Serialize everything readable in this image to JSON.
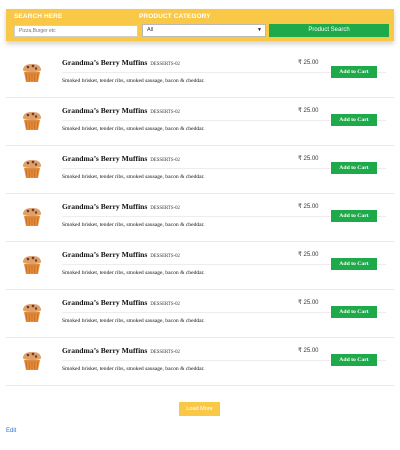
{
  "search": {
    "label": "SEARCH HERE",
    "placeholder": "Pizza,Burger etc",
    "category_label": "PRODUCT CATEGORY",
    "category_value": "All",
    "button_label": "Product Search"
  },
  "products": [
    {
      "name": "Grandma’s Berry Muffins",
      "sku": "DESSERTS-02",
      "price": "25.00",
      "currency_icon": "rupee-icon",
      "description": "Smoked brisket, tender ribs, smoked sausage, bacon & cheddar.",
      "button": "Add to Cart"
    },
    {
      "name": "Grandma’s Berry Muffins",
      "sku": "DESSERTS-02",
      "price": "25.00",
      "currency_icon": "rupee-icon",
      "description": "Smoked brisket, tender ribs, smoked sausage, bacon & cheddar.",
      "button": "Add to Cart"
    },
    {
      "name": "Grandma’s Berry Muffins",
      "sku": "DESSERTS-02",
      "price": "25.00",
      "currency_icon": "rupee-icon",
      "description": "Smoked brisket, tender ribs, smoked sausage, bacon & cheddar.",
      "button": "Add to Cart"
    },
    {
      "name": "Grandma’s Berry Muffins",
      "sku": "DESSERTS-02",
      "price": "25.00",
      "currency_icon": "rupee-icon",
      "description": "Smoked brisket, tender ribs, smoked sausage, bacon & cheddar.",
      "button": "Add to Cart"
    },
    {
      "name": "Grandma’s Berry Muffins",
      "sku": "DESSERTS-02",
      "price": "25.00",
      "currency_icon": "rupee-icon",
      "description": "Smoked brisket, tender ribs, smoked sausage, bacon & cheddar.",
      "button": "Add to Cart"
    },
    {
      "name": "Grandma’s Berry Muffins",
      "sku": "DESSERTS-02",
      "price": "25.00",
      "currency_icon": "rupee-icon",
      "description": "Smoked brisket, tender ribs, smoked sausage, bacon & cheddar.",
      "button": "Add to Cart"
    },
    {
      "name": "Grandma’s Berry Muffins",
      "sku": "DESSERTS-02",
      "price": "25.00",
      "currency_icon": "rupee-icon",
      "description": "Smoked brisket, tender ribs, smoked sausage, bacon & cheddar.",
      "button": "Add to Cart"
    }
  ],
  "load_more_label": "Load More",
  "edit_label": "Edit",
  "colors": {
    "accent": "#f9c846",
    "button": "#1ea94a",
    "link": "#2a73d9"
  }
}
